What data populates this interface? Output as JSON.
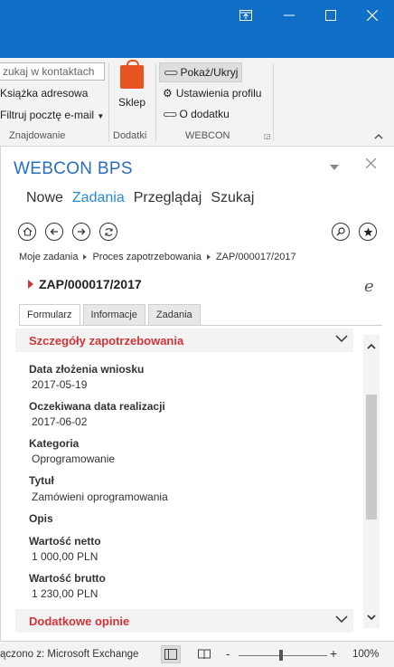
{
  "window": {
    "controls": [
      "dock-icon",
      "minimize-icon",
      "maximize-icon",
      "close-icon"
    ]
  },
  "ribbon": {
    "search_placeholder": "zukaj w kontaktach",
    "find_group": {
      "address_book": "Książka adresowa",
      "filter_email": "Filtruj pocztę e-mail",
      "label": "Znajdowanie"
    },
    "addins_group": {
      "store": "Sklep",
      "label": "Dodatki"
    },
    "webcon_group": {
      "show_hide": "Pokaż/Ukryj",
      "profile_settings": "Ustawienia profilu",
      "about": "O dodatku",
      "label": "WEBCON"
    }
  },
  "pane": {
    "title": "WEBCON BPS",
    "nav": [
      {
        "label": "Nowe",
        "active": false
      },
      {
        "label": "Zadania",
        "active": true
      },
      {
        "label": "Przeglądaj",
        "active": false
      },
      {
        "label": "Szukaj",
        "active": false
      }
    ],
    "breadcrumb": [
      "Moje zadania",
      "Proces zapotrzebowania",
      "ZAP/000017/2017"
    ],
    "document_title": "ZAP/000017/2017",
    "tabs": [
      {
        "label": "Formularz",
        "active": true
      },
      {
        "label": "Informacje",
        "active": false
      },
      {
        "label": "Zadania",
        "active": false
      }
    ],
    "section_details": "Szczegóły zapotrzebowania",
    "fields": [
      {
        "label": "Data złożenia wniosku",
        "value": "2017-05-19"
      },
      {
        "label": "Oczekiwana data realizacji",
        "value": "2017-06-02"
      },
      {
        "label": "Kategoria",
        "value": "Oprogramowanie"
      },
      {
        "label": "Tytuł",
        "value": "Zamówieni oprogramowania"
      },
      {
        "label": "Opis",
        "value": ""
      },
      {
        "label": "Wartość netto",
        "value": "1 000,00 PLN"
      },
      {
        "label": "Wartość brutto",
        "value": "1 230,00 PLN"
      }
    ],
    "section_opinions": "Dodatkowe opinie"
  },
  "status": {
    "connection": "ączono z: Microsoft Exchange",
    "zoom_minus": "-",
    "zoom_plus": "+",
    "zoom": "100%"
  },
  "colors": {
    "titlebar": "#0f6fc6",
    "pane_title": "#2a6ebb",
    "active_tab": "#2a8ad1",
    "accent_red": "#d13438"
  }
}
